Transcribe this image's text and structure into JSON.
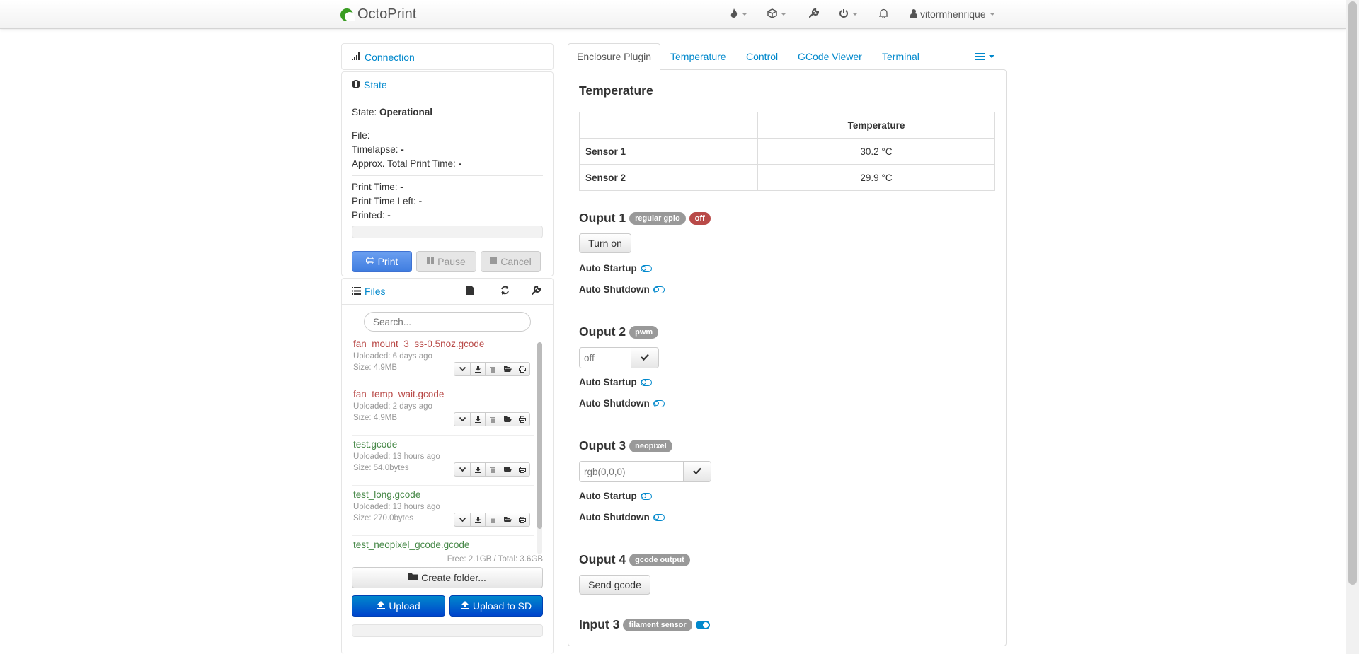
{
  "navbar": {
    "brand": "OctoPrint",
    "user": "vitormhenrique"
  },
  "sidebar": {
    "connection": {
      "title": "Connection"
    },
    "state": {
      "title": "State",
      "state_label": "State:",
      "state_value": "Operational",
      "file_label": "File:",
      "file_value": "",
      "timelapse_label": "Timelapse:",
      "timelapse_value": "-",
      "approx_label": "Approx. Total Print Time:",
      "approx_value": "-",
      "print_time_label": "Print Time:",
      "print_time_value": "-",
      "time_left_label": "Print Time Left:",
      "time_left_value": "-",
      "printed_label": "Printed:",
      "printed_value": "-",
      "buttons": {
        "print": "Print",
        "pause": "Pause",
        "cancel": "Cancel"
      }
    },
    "files": {
      "title": "Files",
      "search_placeholder": "Search...",
      "items": [
        {
          "name": "fan_mount_3_ss-0.5noz.gcode",
          "uploaded": "Uploaded: 6 days ago",
          "size": "Size: 4.9MB",
          "status": "red"
        },
        {
          "name": "fan_temp_wait.gcode",
          "uploaded": "Uploaded: 2 days ago",
          "size": "Size: 4.9MB",
          "status": "red"
        },
        {
          "name": "test.gcode",
          "uploaded": "Uploaded: 13 hours ago",
          "size": "Size: 54.0bytes",
          "status": "green"
        },
        {
          "name": "test_long.gcode",
          "uploaded": "Uploaded: 13 hours ago",
          "size": "Size: 270.0bytes",
          "status": "green"
        },
        {
          "name": "test_neopixel_gcode.gcode",
          "uploaded": "",
          "size": "",
          "status": "green"
        }
      ],
      "free_total": "Free: 2.1GB / Total: 3.6GB",
      "create_folder": "Create folder...",
      "upload": "Upload",
      "upload_sd": "Upload to SD"
    }
  },
  "tabs": [
    "Enclosure Plugin",
    "Temperature",
    "Control",
    "GCode Viewer",
    "Terminal"
  ],
  "enclosure": {
    "temperature_title": "Temperature",
    "table_header": "Temperature",
    "sensors": [
      {
        "name": "Sensor 1",
        "value": "30.2 °C"
      },
      {
        "name": "Sensor 2",
        "value": "29.9 °C"
      }
    ],
    "auto_startup": "Auto Startup",
    "auto_shutdown": "Auto Shutdown",
    "outputs": [
      {
        "title": "Ouput 1",
        "badge": "regular gpio",
        "badge2": "off",
        "button": "Turn on"
      },
      {
        "title": "Ouput 2",
        "badge": "pwm",
        "placeholder": "off"
      },
      {
        "title": "Ouput 3",
        "badge": "neopixel",
        "placeholder": "rgb(0,0,0)"
      },
      {
        "title": "Ouput 4",
        "badge": "gcode output",
        "button": "Send gcode"
      }
    ],
    "input": {
      "title": "Input 3",
      "badge": "filament sensor"
    }
  },
  "colors": {
    "link": "#0088cc",
    "primary": "#3f7de0",
    "danger": "#b94a48",
    "success": "#468847"
  }
}
